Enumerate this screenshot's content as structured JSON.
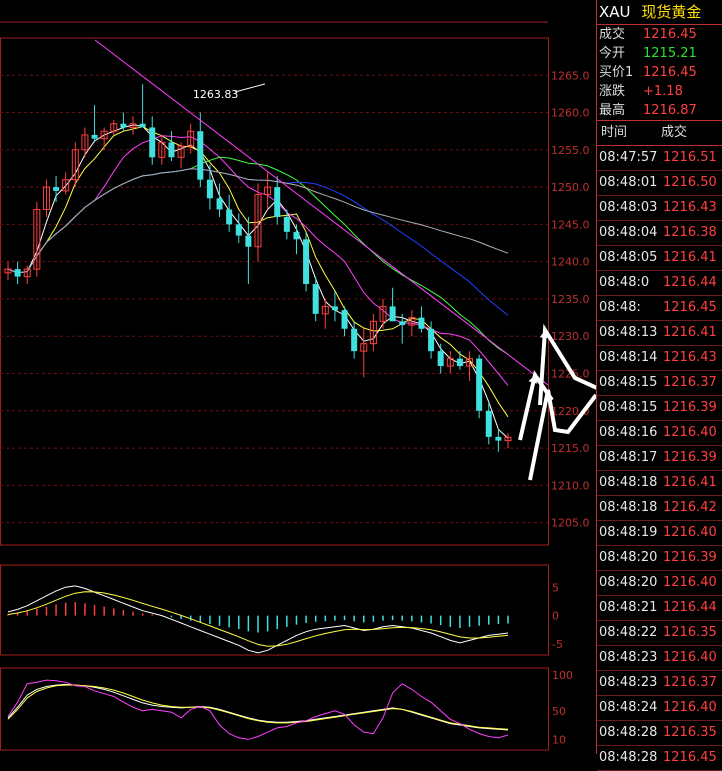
{
  "header": {
    "symbol": "XAU",
    "name": "现货黄金"
  },
  "quote": [
    {
      "label": "成交",
      "value": "1216.45",
      "color": "#ff4040"
    },
    {
      "label": "今开",
      "value": "1215.21",
      "color": "#30e030"
    },
    {
      "label": "买价1",
      "value": "1216.45",
      "color": "#ff4040"
    },
    {
      "label": "涨跌",
      "value": "+1.18",
      "color": "#ff4040"
    },
    {
      "label": "最高",
      "value": "1216.87",
      "color": "#ff4040"
    }
  ],
  "ticks_header": {
    "time": "时间",
    "price": "成交"
  },
  "ticks": [
    {
      "time": "08:47:57",
      "price": "1216.51"
    },
    {
      "time": "08:48:01",
      "price": "1216.50"
    },
    {
      "time": "08:48:03",
      "price": "1216.43"
    },
    {
      "time": "08:48:04",
      "price": "1216.38"
    },
    {
      "time": "08:48:05",
      "price": "1216.41"
    },
    {
      "time": "08:48:0",
      "price": "1216.44"
    },
    {
      "time": "08:48:",
      "price": "1216.45"
    },
    {
      "time": "08:48:13",
      "price": "1216.41"
    },
    {
      "time": "08:48:14",
      "price": "1216.43"
    },
    {
      "time": "08:48:15",
      "price": "1216.37"
    },
    {
      "time": "08:48:15",
      "price": "1216.39"
    },
    {
      "time": "08:48:16",
      "price": "1216.40"
    },
    {
      "time": "08:48:17",
      "price": "1216.39"
    },
    {
      "time": "08:48:18",
      "price": "1216.41"
    },
    {
      "time": "08:48:18",
      "price": "1216.42"
    },
    {
      "time": "08:48:19",
      "price": "1216.40"
    },
    {
      "time": "08:48:20",
      "price": "1216.39"
    },
    {
      "time": "08:48:20",
      "price": "1216.40"
    },
    {
      "time": "08:48:21",
      "price": "1216.44"
    },
    {
      "time": "08:48:22",
      "price": "1216.35"
    },
    {
      "time": "08:48:23",
      "price": "1216.40"
    },
    {
      "time": "08:48:23",
      "price": "1216.37"
    },
    {
      "time": "08:48:24",
      "price": "1216.40"
    },
    {
      "time": "08:48:28",
      "price": "1216.35"
    },
    {
      "time": "08:48:28",
      "price": "1216.45"
    }
  ],
  "chart_data": [
    {
      "type": "candlestick",
      "ylim": [
        1202,
        1270
      ],
      "yticks": [
        "1265.0",
        "1260.0",
        "1255.0",
        "1250.0",
        "1245.0",
        "1240.0",
        "1235.0",
        "1230.0",
        "1225.0",
        "1220.0",
        "1215.0",
        "1210.0",
        "1205.0"
      ],
      "ytick_values": [
        1265,
        1260,
        1255,
        1250,
        1245,
        1240,
        1235,
        1230,
        1225,
        1220,
        1215,
        1210,
        1205
      ],
      "annotation": {
        "text": "1263.83",
        "index": 21,
        "value": 1263.83
      },
      "candles": [
        {
          "o": 1238.5,
          "h": 1240,
          "l": 1237.5,
          "c": 1239
        },
        {
          "o": 1239,
          "h": 1240,
          "l": 1237,
          "c": 1238
        },
        {
          "o": 1238,
          "h": 1239.5,
          "l": 1237,
          "c": 1239
        },
        {
          "o": 1239,
          "h": 1248,
          "l": 1238,
          "c": 1247
        },
        {
          "o": 1247,
          "h": 1251,
          "l": 1246,
          "c": 1250
        },
        {
          "o": 1250,
          "h": 1251.5,
          "l": 1248,
          "c": 1249.5
        },
        {
          "o": 1249.5,
          "h": 1252,
          "l": 1249,
          "c": 1251
        },
        {
          "o": 1251,
          "h": 1256,
          "l": 1250,
          "c": 1255
        },
        {
          "o": 1255,
          "h": 1258,
          "l": 1254,
          "c": 1257
        },
        {
          "o": 1257,
          "h": 1261,
          "l": 1256,
          "c": 1256.5
        },
        {
          "o": 1256.5,
          "h": 1258,
          "l": 1255,
          "c": 1257.5
        },
        {
          "o": 1257.5,
          "h": 1259,
          "l": 1257,
          "c": 1258.5
        },
        {
          "o": 1258.5,
          "h": 1260,
          "l": 1257.5,
          "c": 1258
        },
        {
          "o": 1258,
          "h": 1259.5,
          "l": 1257,
          "c": 1258.5
        },
        {
          "o": 1258.5,
          "h": 1263.8,
          "l": 1258,
          "c": 1258
        },
        {
          "o": 1258,
          "h": 1259.5,
          "l": 1253,
          "c": 1254
        },
        {
          "o": 1254,
          "h": 1257,
          "l": 1253,
          "c": 1256
        },
        {
          "o": 1256,
          "h": 1257.5,
          "l": 1253.5,
          "c": 1254
        },
        {
          "o": 1254,
          "h": 1256,
          "l": 1252.5,
          "c": 1255.5
        },
        {
          "o": 1255.5,
          "h": 1258.5,
          "l": 1254.5,
          "c": 1257.5
        },
        {
          "o": 1257.5,
          "h": 1260,
          "l": 1250,
          "c": 1251
        },
        {
          "o": 1251,
          "h": 1253,
          "l": 1247,
          "c": 1248.5
        },
        {
          "o": 1248.5,
          "h": 1250.5,
          "l": 1246,
          "c": 1247
        },
        {
          "o": 1247,
          "h": 1249,
          "l": 1244,
          "c": 1245
        },
        {
          "o": 1245,
          "h": 1246.5,
          "l": 1242.5,
          "c": 1243.5
        },
        {
          "o": 1243.5,
          "h": 1246,
          "l": 1237,
          "c": 1242
        },
        {
          "o": 1242,
          "h": 1250.5,
          "l": 1240,
          "c": 1249
        },
        {
          "o": 1249,
          "h": 1252,
          "l": 1247,
          "c": 1250
        },
        {
          "o": 1250,
          "h": 1251.5,
          "l": 1245,
          "c": 1246
        },
        {
          "o": 1246,
          "h": 1247,
          "l": 1243,
          "c": 1244
        },
        {
          "o": 1244,
          "h": 1245,
          "l": 1241,
          "c": 1243
        },
        {
          "o": 1243,
          "h": 1244,
          "l": 1236,
          "c": 1237
        },
        {
          "o": 1237,
          "h": 1238,
          "l": 1232,
          "c": 1233
        },
        {
          "o": 1233,
          "h": 1235,
          "l": 1231,
          "c": 1234
        },
        {
          "o": 1234,
          "h": 1236,
          "l": 1232,
          "c": 1233.5
        },
        {
          "o": 1233.5,
          "h": 1234,
          "l": 1230,
          "c": 1231
        },
        {
          "o": 1231,
          "h": 1232,
          "l": 1227,
          "c": 1228
        },
        {
          "o": 1228,
          "h": 1231,
          "l": 1224.5,
          "c": 1229
        },
        {
          "o": 1229,
          "h": 1233,
          "l": 1228,
          "c": 1232
        },
        {
          "o": 1232,
          "h": 1235,
          "l": 1231,
          "c": 1234
        },
        {
          "o": 1234,
          "h": 1236.5,
          "l": 1233,
          "c": 1232
        },
        {
          "o": 1232,
          "h": 1233,
          "l": 1229,
          "c": 1231.5
        },
        {
          "o": 1231.5,
          "h": 1233.5,
          "l": 1230,
          "c": 1232.5
        },
        {
          "o": 1232.5,
          "h": 1234,
          "l": 1230.5,
          "c": 1231
        },
        {
          "o": 1231,
          "h": 1232,
          "l": 1227,
          "c": 1228
        },
        {
          "o": 1228,
          "h": 1229,
          "l": 1225,
          "c": 1226
        },
        {
          "o": 1226,
          "h": 1228,
          "l": 1225,
          "c": 1227
        },
        {
          "o": 1227,
          "h": 1228,
          "l": 1225.5,
          "c": 1226
        },
        {
          "o": 1226,
          "h": 1228,
          "l": 1224,
          "c": 1227
        },
        {
          "o": 1227,
          "h": 1227.5,
          "l": 1219,
          "c": 1220
        },
        {
          "o": 1220,
          "h": 1221,
          "l": 1215.5,
          "c": 1216.5
        },
        {
          "o": 1216.5,
          "h": 1217.5,
          "l": 1214.5,
          "c": 1216
        },
        {
          "o": 1216,
          "h": 1217,
          "l": 1215,
          "c": 1216.45
        }
      ]
    },
    {
      "type": "bar",
      "name": "MACD",
      "ylim": [
        -7,
        9
      ],
      "yticks": [
        "5",
        "0",
        "-5"
      ],
      "ytick_values": [
        5,
        0,
        -5
      ],
      "values": [
        0.3,
        0.5,
        0.8,
        1.2,
        1.6,
        2.0,
        2.3,
        2.4,
        2.2,
        1.9,
        1.6,
        1.3,
        1.0,
        0.7,
        0.4,
        0.2,
        0.0,
        -0.3,
        -0.6,
        -0.9,
        -1.2,
        -1.5,
        -1.8,
        -2.1,
        -2.4,
        -2.8,
        -3.0,
        -2.8,
        -2.4,
        -2.0,
        -1.6,
        -1.3,
        -1.1,
        -1.0,
        -0.9,
        -0.8,
        -1.0,
        -1.2,
        -1.1,
        -0.9,
        -0.8,
        -0.9,
        -1.0,
        -1.2,
        -1.4,
        -1.7,
        -2.0,
        -2.2,
        -2.0,
        -1.8,
        -1.6,
        -1.5,
        -1.4
      ]
    },
    {
      "type": "line",
      "name": "KDJ",
      "ylim": [
        -5,
        110
      ],
      "yticks": [
        "100",
        "50",
        "10"
      ],
      "ytick_values": [
        100,
        50,
        10
      ],
      "series": [
        {
          "color": "#ffffff",
          "values": [
            40,
            55,
            72,
            80,
            84,
            86,
            87,
            86,
            85,
            83,
            80,
            76,
            71,
            66,
            61,
            58,
            56,
            55,
            54,
            55,
            56,
            55,
            52,
            48,
            44,
            40,
            37,
            35,
            34,
            34,
            35,
            36,
            38,
            40,
            42,
            44,
            46,
            48,
            50,
            52,
            54,
            52,
            48,
            44,
            40,
            36,
            32,
            30,
            28,
            26,
            25,
            24,
            23
          ]
        },
        {
          "color": "#ffff40",
          "values": [
            38,
            52,
            68,
            77,
            82,
            85,
            86,
            86,
            85,
            84,
            82,
            79,
            75,
            70,
            65,
            61,
            58,
            56,
            55,
            55,
            55,
            54,
            51,
            47,
            43,
            39,
            36,
            34,
            33,
            33,
            34,
            35,
            37,
            39,
            41,
            43,
            45,
            47,
            49,
            51,
            53,
            52,
            49,
            45,
            41,
            37,
            33,
            31,
            29,
            27,
            26,
            25,
            24
          ]
        },
        {
          "color": "#ff40ff",
          "values": [
            42,
            62,
            88,
            90,
            93,
            92,
            90,
            85,
            84,
            78,
            74,
            70,
            62,
            55,
            50,
            52,
            50,
            48,
            40,
            52,
            56,
            50,
            30,
            18,
            12,
            10,
            14,
            20,
            26,
            28,
            33,
            36,
            42,
            46,
            50,
            45,
            30,
            20,
            18,
            40,
            75,
            88,
            80,
            70,
            62,
            50,
            38,
            32,
            24,
            18,
            14,
            12,
            16
          ]
        }
      ]
    }
  ]
}
